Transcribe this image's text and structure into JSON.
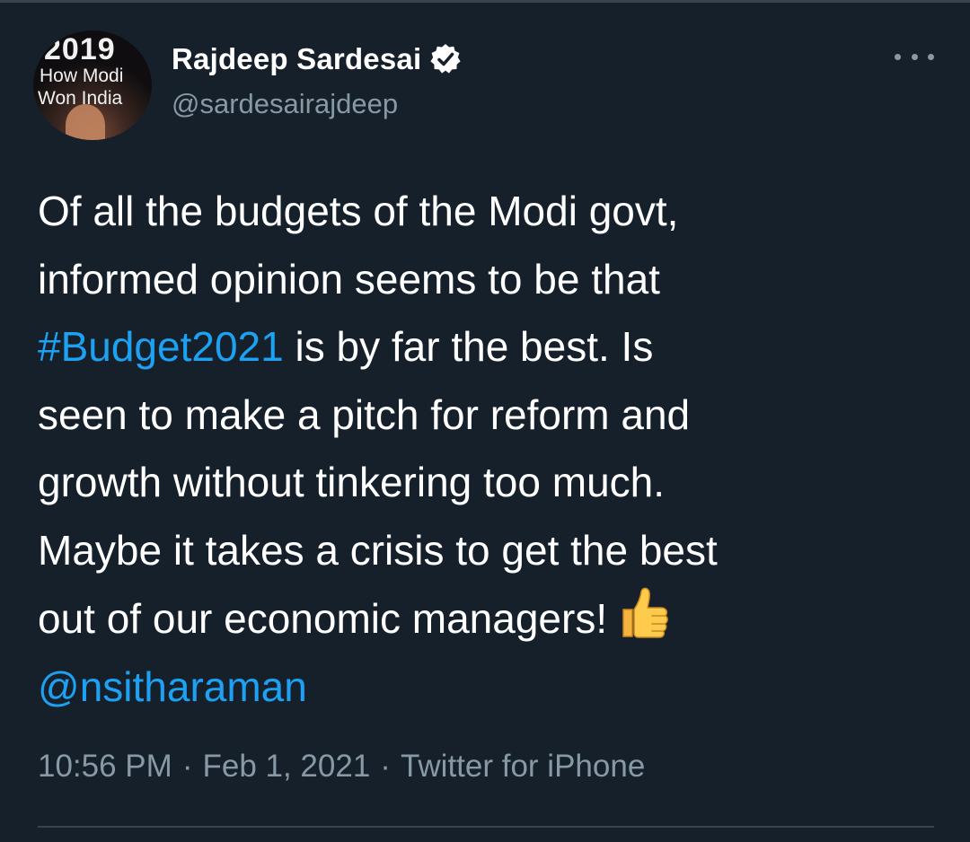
{
  "author": {
    "display_name": "Rajdeep Sardesai",
    "handle": "@sardesairajdeep",
    "verified": true,
    "avatar_text": [
      "2019",
      "How Modi",
      "Won India"
    ]
  },
  "tweet": {
    "lines": [
      "Of all the budgets of the Modi govt,",
      "informed opinion seems to be that",
      "is by far the best. Is",
      "seen to make a pitch for reform and",
      "growth without tinkering too much.",
      "Maybe it takes a crisis to get the best",
      "out of our economic managers!"
    ],
    "hashtag": "#Budget2021",
    "mention": "@nsitharaman",
    "emoji": "thumbs-up-icon"
  },
  "meta": {
    "time": "10:56 PM",
    "date": "Feb 1, 2021",
    "source": "Twitter for iPhone",
    "separator": "·"
  },
  "colors": {
    "background": "#15202b",
    "link": "#1da1f2",
    "secondary_text": "#8899a6",
    "divider": "#38444d"
  }
}
